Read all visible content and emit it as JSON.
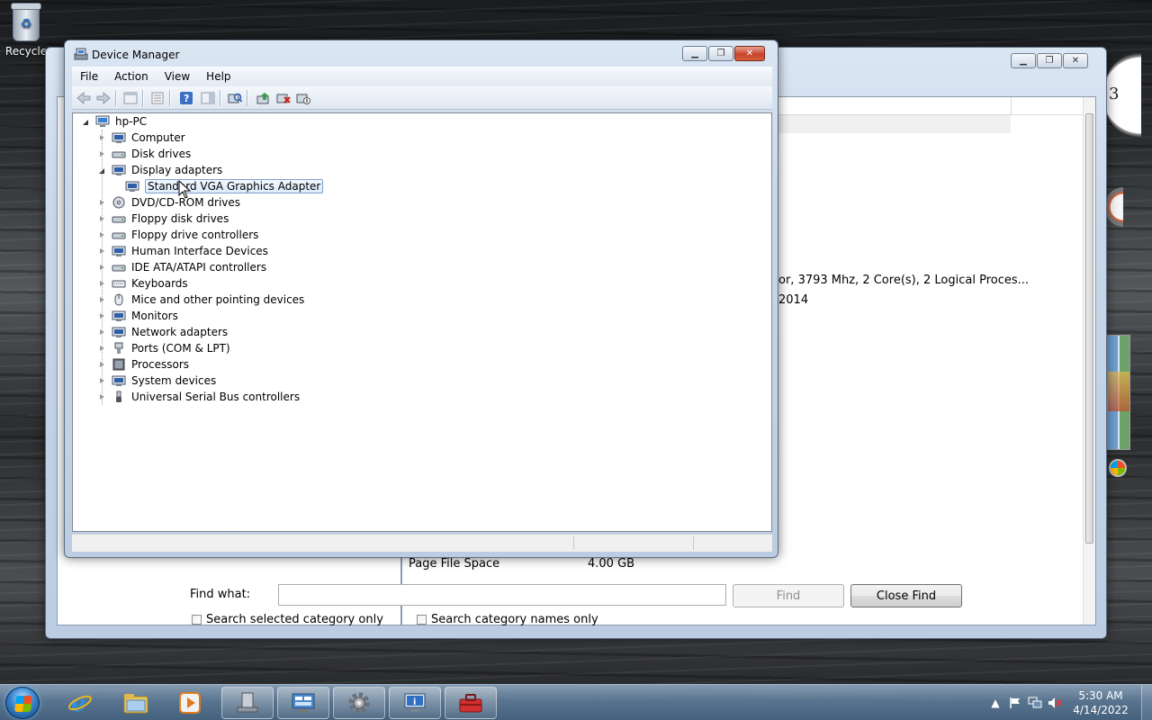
{
  "desktop": {
    "recycle_label": "Recycle"
  },
  "sysinfo": {
    "info_processor": "or, 3793 Mhz, 2 Core(s), 2 Logical Proces...",
    "info_year": "2014",
    "page_file_label": "Page File Space",
    "page_file_value": "4.00 GB",
    "find_label": "Find what:",
    "find_value": "",
    "find_button": "Find",
    "close_find_button": "Close Find",
    "chk_selected_category": "Search selected category only",
    "chk_category_names": "Search category names only"
  },
  "devmgr": {
    "title": "Device Manager",
    "menu": [
      "File",
      "Action",
      "View",
      "Help"
    ],
    "root": "hp-PC",
    "items": [
      {
        "label": "Computer",
        "expanded": false
      },
      {
        "label": "Disk drives",
        "expanded": false
      },
      {
        "label": "Display adapters",
        "expanded": true
      },
      {
        "label": "Standard VGA Graphics Adapter",
        "child": true,
        "selected": true
      },
      {
        "label": "DVD/CD-ROM drives",
        "expanded": false
      },
      {
        "label": "Floppy disk drives",
        "expanded": false
      },
      {
        "label": "Floppy drive controllers",
        "expanded": false
      },
      {
        "label": "Human Interface Devices",
        "expanded": false
      },
      {
        "label": "IDE ATA/ATAPI controllers",
        "expanded": false
      },
      {
        "label": "Keyboards",
        "expanded": false
      },
      {
        "label": "Mice and other pointing devices",
        "expanded": false
      },
      {
        "label": "Monitors",
        "expanded": false
      },
      {
        "label": "Network adapters",
        "expanded": false
      },
      {
        "label": "Ports (COM & LPT)",
        "expanded": false
      },
      {
        "label": "Processors",
        "expanded": false
      },
      {
        "label": "System devices",
        "expanded": false
      },
      {
        "label": "Universal Serial Bus controllers",
        "expanded": false
      }
    ]
  },
  "taskbar": {
    "time": "5:30 AM",
    "date": "4/14/2022"
  },
  "colors": {
    "selection_border": "#7da2ce",
    "close_button": "#c7432b"
  }
}
